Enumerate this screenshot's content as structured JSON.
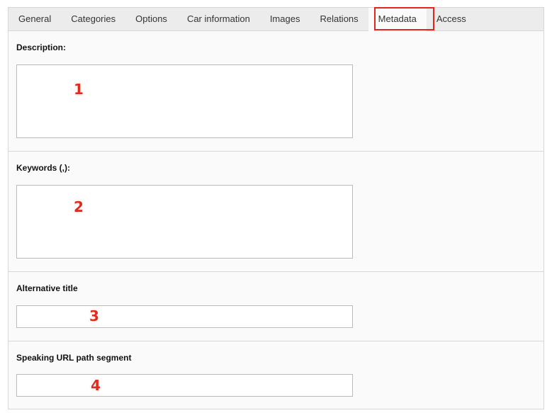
{
  "tabs": [
    {
      "label": "General",
      "active": false
    },
    {
      "label": "Categories",
      "active": false
    },
    {
      "label": "Options",
      "active": false
    },
    {
      "label": "Car information",
      "active": false
    },
    {
      "label": "Images",
      "active": false
    },
    {
      "label": "Relations",
      "active": false
    },
    {
      "label": "Metadata",
      "active": true
    },
    {
      "label": "Access",
      "active": false
    }
  ],
  "highlight_color": "#e5241d",
  "fields": {
    "description": {
      "label": "Description:",
      "value": "",
      "marker": "1"
    },
    "keywords": {
      "label": "Keywords (,):",
      "value": "",
      "marker": "2"
    },
    "alternative_title": {
      "label": "Alternative title",
      "value": "",
      "marker": "3"
    },
    "speaking_url": {
      "label": "Speaking URL path segment",
      "value": "",
      "marker": "4"
    }
  }
}
